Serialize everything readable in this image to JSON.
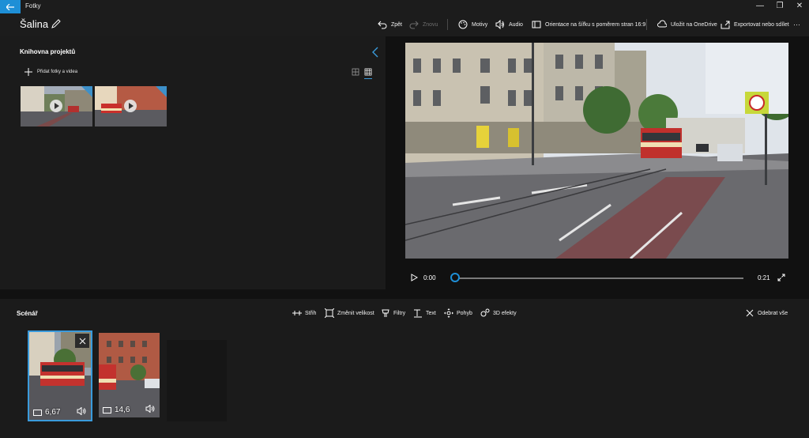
{
  "titlebar": {
    "app_name": "Fotky",
    "back_icon": "arrow-left-icon",
    "minimize_glyph": "—",
    "restore_glyph": "❐",
    "close_glyph": "✕"
  },
  "header": {
    "project_title": "Šalina",
    "toolbar": {
      "undo": "Zpět",
      "redo": "Znovu",
      "themes": "Motivy",
      "audio": "Audio",
      "orientation": "Orientace na šířku s poměrem stran 16:9",
      "save_onedrive": "Uložit na OneDrive",
      "export": "Exportovat nebo sdílet",
      "more": "···"
    }
  },
  "library": {
    "title": "Knihovna projektů",
    "add_button": "Přidat fotky a videa",
    "items": [
      {
        "name": "media-item-1",
        "kind": "video"
      },
      {
        "name": "media-item-2",
        "kind": "video"
      }
    ]
  },
  "preview": {
    "time_current": "0:00",
    "time_total": "0:21",
    "progress": 0.0
  },
  "storyboard": {
    "title": "Scénář",
    "tools": {
      "trim": "Střih",
      "resize": "Změnit velikost",
      "filters": "Filtry",
      "text": "Text",
      "motion": "Pohyb",
      "effects_3d": "3D efekty",
      "remove_all": "Odebrat vše"
    },
    "clips": [
      {
        "duration": "6,67",
        "selected": true
      },
      {
        "duration": "14,6",
        "selected": false
      }
    ]
  },
  "colors": {
    "accent": "#1e8fd6",
    "background": "#111111",
    "panel": "#1b1b1b"
  }
}
